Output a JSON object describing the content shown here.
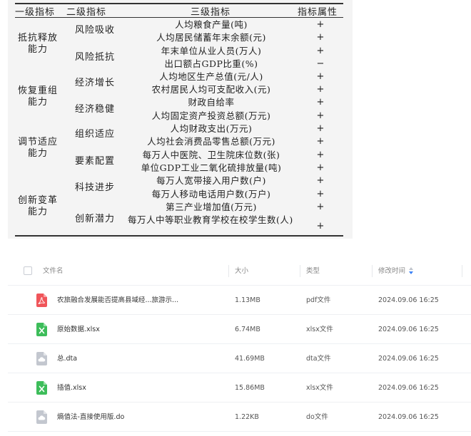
{
  "indicator_table": {
    "headers": {
      "level1": "一级指标",
      "level2": "二级指标",
      "level3": "三级指标",
      "attr": "指标属性"
    },
    "groups": [
      {
        "level1": "抵抗释放能力",
        "subgroups": [
          {
            "level2": "风险吸收",
            "rows": [
              {
                "name": "人均粮食产量(吨)",
                "sign": "+"
              },
              {
                "name": "人均居民储蓄年末余额(元)",
                "sign": "+"
              }
            ]
          },
          {
            "level2": "风险抵抗",
            "rows": [
              {
                "name": "年末单位从业人员(万人)",
                "sign": "+"
              },
              {
                "name": "出口额占GDP比重(%)",
                "sign": "−"
              }
            ]
          }
        ]
      },
      {
        "level1": "恢复重组能力",
        "subgroups": [
          {
            "level2": "经济增长",
            "rows": [
              {
                "name": "人均地区生产总值(元/人)",
                "sign": "+"
              },
              {
                "name": "农村居民人均可支配收入(元)",
                "sign": "+"
              }
            ]
          },
          {
            "level2": "经济稳健",
            "rows": [
              {
                "name": "财政自给率",
                "sign": "+"
              },
              {
                "name": "人均固定资产投资总额(万元)",
                "sign": "+"
              }
            ]
          }
        ]
      },
      {
        "level1": "调节适应能力",
        "subgroups": [
          {
            "level2": "组织适应",
            "rows": [
              {
                "name": "人均财政支出(万元)",
                "sign": "+"
              },
              {
                "name": "人均社会消费品零售总额(万元)",
                "sign": "+"
              }
            ]
          },
          {
            "level2": "要素配置",
            "rows": [
              {
                "name": "每万人中医院、卫生院床位数(张)",
                "sign": "+"
              },
              {
                "name": "单位GDP工业二氧化硫排放量(吨)",
                "sign": "+"
              }
            ]
          }
        ]
      },
      {
        "level1": "创新变革能力",
        "subgroups": [
          {
            "level2": "科技进步",
            "rows": [
              {
                "name": "每万人宽带接入用户数(户)",
                "sign": "+"
              },
              {
                "name": "每万人移动电话用户数(万户)",
                "sign": "+"
              }
            ]
          },
          {
            "level2": "创新潜力",
            "rows": [
              {
                "name": "第三产业增加值(万元)",
                "sign": "+"
              },
              {
                "name": "每万人中等职业教育学校在校学生数(人)",
                "sign": "+"
              }
            ]
          }
        ]
      }
    ]
  },
  "file_list": {
    "columns": {
      "name": "文件名",
      "size": "大小",
      "type": "类型",
      "time": "修改时间"
    },
    "files": [
      {
        "name": "农旅融合发展能否提高县域经...旅游示...",
        "size": "1.13MB",
        "type": "pdf文件",
        "time": "2024.09.06 16:25",
        "icon": "pdf-icon",
        "color": "#f0555a"
      },
      {
        "name": "原始数据.xlsx",
        "size": "6.74MB",
        "type": "xlsx文件",
        "time": "2024.09.06 16:25",
        "icon": "excel-icon",
        "color": "#3dbd5a"
      },
      {
        "name": "总.dta",
        "size": "41.69MB",
        "type": "dta文件",
        "time": "2024.09.06 16:25",
        "icon": "generic-file-icon",
        "color": "#c3c7cf"
      },
      {
        "name": "插值.xlsx",
        "size": "15.86MB",
        "type": "xlsx文件",
        "time": "2024.09.06 16:25",
        "icon": "excel-icon",
        "color": "#3dbd5a"
      },
      {
        "name": "熵值法-直接使用版.do",
        "size": "1.22KB",
        "type": "do文件",
        "time": "2024.09.06 16:25",
        "icon": "generic-file-icon",
        "color": "#c3c7cf"
      }
    ]
  },
  "colors": {
    "accent": "#3b82f6",
    "pdf": "#f0555a",
    "excel": "#3dbd5a",
    "generic": "#c3c7cf"
  }
}
